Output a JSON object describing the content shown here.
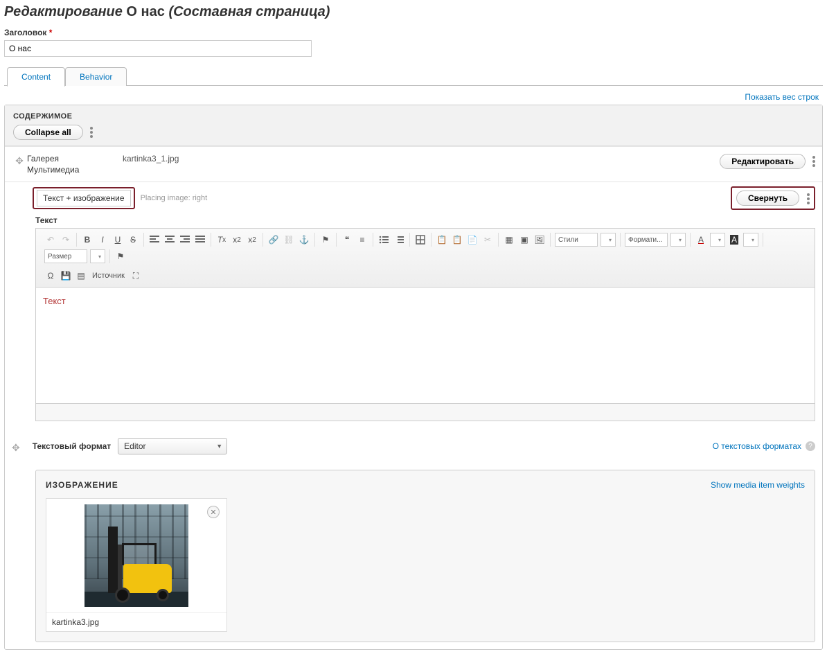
{
  "title": {
    "prefix": "Редактирование",
    "page_name": "О нас",
    "suffix": "(Составная страница)"
  },
  "form": {
    "title_label": "Заголовок",
    "title_value": "О нас"
  },
  "tabs": {
    "items": [
      {
        "label": "Content",
        "active": true
      },
      {
        "label": "Behavior",
        "active": false
      }
    ],
    "show_weights": "Показать вес строк"
  },
  "content_section": {
    "label": "СОДЕРЖИМОЕ",
    "collapse_all": "Collapse all"
  },
  "row_gallery": {
    "line1": "Галерея",
    "line2": "Мультимедиа",
    "meta": "kartinka3_1.jpg",
    "edit_btn": "Редактировать"
  },
  "row_textimg": {
    "type_label": "Текст + изображение",
    "placing": "Placing image: right",
    "collapse_btn": "Свернуть",
    "field_text_label": "Текст",
    "editor_placeholder": "Текст",
    "format_label": "Текстовый формат",
    "format_value": "Editor",
    "format_help": "О текстовых форматах"
  },
  "editor_toolbar": {
    "combos": {
      "styles": "Стили",
      "format": "Формати...",
      "size": "Размер"
    },
    "source": "Источник"
  },
  "image_section": {
    "title": "ИЗОБРАЖЕНИЕ",
    "show_weights": "Show media item weights",
    "caption": "kartinka3.jpg"
  }
}
